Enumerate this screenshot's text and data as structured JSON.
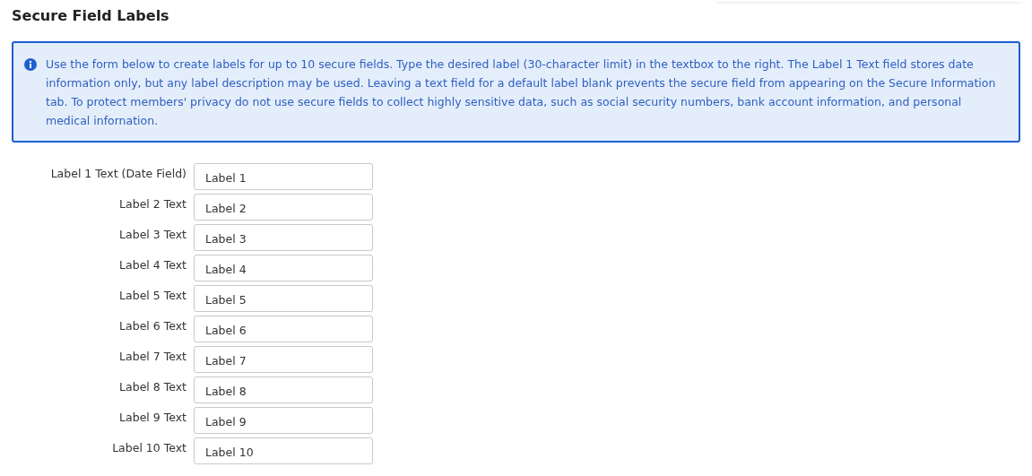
{
  "title": "Secure Field Labels",
  "info": "Use the form below to create labels for up to 10 secure fields. Type the desired label (30-character limit) in the textbox to the right. The Label 1 Text field stores date information only, but any label description may be used. Leaving a text field for a default label blank prevents the secure field from appearing on the Secure Information tab. To protect members' privacy do not use secure fields to collect highly sensitive data, such as social security numbers, bank account information, and personal medical infornation.",
  "fields": [
    {
      "label": "Label 1 Text (Date Field)",
      "value": "Label 1"
    },
    {
      "label": "Label 2 Text",
      "value": "Label 2"
    },
    {
      "label": "Label 3 Text",
      "value": "Label 3"
    },
    {
      "label": "Label 4 Text",
      "value": "Label 4"
    },
    {
      "label": "Label 5 Text",
      "value": "Label 5"
    },
    {
      "label": "Label 6 Text",
      "value": "Label 6"
    },
    {
      "label": "Label 7 Text",
      "value": "Label 7"
    },
    {
      "label": "Label 8 Text",
      "value": "Label 8"
    },
    {
      "label": "Label 9 Text",
      "value": "Label 9"
    },
    {
      "label": "Label 10 Text",
      "value": "Label 10"
    }
  ]
}
